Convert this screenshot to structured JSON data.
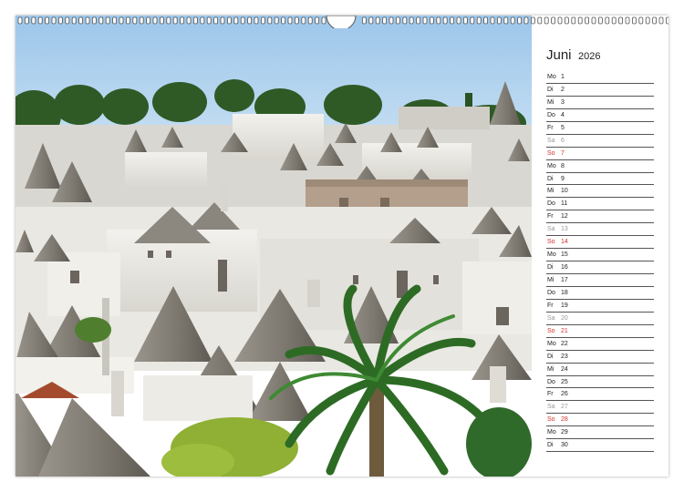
{
  "calendar": {
    "month": "Juni",
    "year": "2026",
    "days": [
      {
        "wd": "Mo",
        "d": "1",
        "type": "weekday"
      },
      {
        "wd": "Di",
        "d": "2",
        "type": "weekday"
      },
      {
        "wd": "Mi",
        "d": "3",
        "type": "weekday"
      },
      {
        "wd": "Do",
        "d": "4",
        "type": "weekday"
      },
      {
        "wd": "Fr",
        "d": "5",
        "type": "weekday"
      },
      {
        "wd": "Sa",
        "d": "6",
        "type": "sat"
      },
      {
        "wd": "So",
        "d": "7",
        "type": "sun"
      },
      {
        "wd": "Mo",
        "d": "8",
        "type": "weekday"
      },
      {
        "wd": "Di",
        "d": "9",
        "type": "weekday"
      },
      {
        "wd": "Mi",
        "d": "10",
        "type": "weekday"
      },
      {
        "wd": "Do",
        "d": "11",
        "type": "weekday"
      },
      {
        "wd": "Fr",
        "d": "12",
        "type": "weekday"
      },
      {
        "wd": "Sa",
        "d": "13",
        "type": "sat"
      },
      {
        "wd": "So",
        "d": "14",
        "type": "sun"
      },
      {
        "wd": "Mo",
        "d": "15",
        "type": "weekday"
      },
      {
        "wd": "Di",
        "d": "16",
        "type": "weekday"
      },
      {
        "wd": "Mi",
        "d": "17",
        "type": "weekday"
      },
      {
        "wd": "Do",
        "d": "18",
        "type": "weekday"
      },
      {
        "wd": "Fr",
        "d": "19",
        "type": "weekday"
      },
      {
        "wd": "Sa",
        "d": "20",
        "type": "sat"
      },
      {
        "wd": "So",
        "d": "21",
        "type": "sun"
      },
      {
        "wd": "Mo",
        "d": "22",
        "type": "weekday"
      },
      {
        "wd": "Di",
        "d": "23",
        "type": "weekday"
      },
      {
        "wd": "Mi",
        "d": "24",
        "type": "weekday"
      },
      {
        "wd": "Do",
        "d": "25",
        "type": "weekday"
      },
      {
        "wd": "Fr",
        "d": "26",
        "type": "weekday"
      },
      {
        "wd": "Sa",
        "d": "27",
        "type": "sat"
      },
      {
        "wd": "So",
        "d": "28",
        "type": "sun"
      },
      {
        "wd": "Mo",
        "d": "29",
        "type": "weekday"
      },
      {
        "wd": "Di",
        "d": "30",
        "type": "weekday"
      }
    ]
  },
  "colors": {
    "sunday": "#d0342c",
    "saturday": "#9a9a9a",
    "weekday": "#222222",
    "sky": "#a9cdeb"
  },
  "photo": {
    "subject": "trulli-houses-scene"
  }
}
